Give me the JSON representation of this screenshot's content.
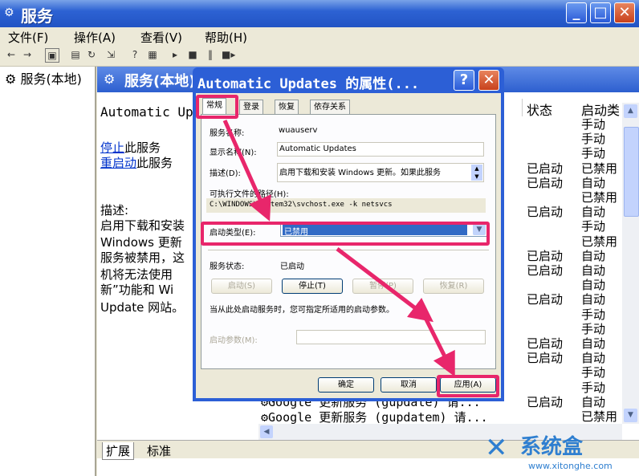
{
  "window": {
    "title": "服务",
    "minimize": "_",
    "maximize": "□",
    "close": "✕"
  },
  "menu": [
    "文件(F)",
    "操作(A)",
    "查看(V)",
    "帮助(H)"
  ],
  "left_pane": {
    "item": "服务(本地)"
  },
  "right_pane": {
    "header": "服务(本地)",
    "service_name": "Automatic Updates",
    "stop_link": "停止",
    "stop_suffix": "此服务",
    "restart_link": "重启动",
    "restart_suffix": "此服务",
    "desc_lines": [
      "描述:",
      "启用下载和安装",
      "Windows 更新",
      "服务被禁用，这",
      "机将无法使用",
      "新”功能和 Wi",
      "Update 网站。"
    ],
    "col_status": "状态",
    "col_startup": "启动类",
    "rows": [
      {
        "status": "",
        "startup": "手动"
      },
      {
        "status": "",
        "startup": "手动"
      },
      {
        "status": "",
        "startup": "手动"
      },
      {
        "status": "已启动",
        "startup": "已禁用"
      },
      {
        "status": "已启动",
        "startup": "自动"
      },
      {
        "status": "",
        "startup": "已禁用"
      },
      {
        "status": "已启动",
        "startup": "自动"
      },
      {
        "status": "",
        "startup": "手动"
      },
      {
        "status": "",
        "startup": "已禁用"
      },
      {
        "status": "已启动",
        "startup": "自动"
      },
      {
        "status": "已启动",
        "startup": "自动"
      },
      {
        "status": "",
        "startup": "自动"
      },
      {
        "status": "已启动",
        "startup": "自动"
      },
      {
        "status": "",
        "startup": "手动"
      },
      {
        "status": "",
        "startup": "手动"
      },
      {
        "status": "已启动",
        "startup": "自动"
      },
      {
        "status": "已启动",
        "startup": "自动"
      },
      {
        "status": "",
        "startup": "手动"
      },
      {
        "status": "",
        "startup": "手动"
      },
      {
        "status": "已启动",
        "startup": "自动"
      },
      {
        "status": "",
        "startup": "已禁用"
      },
      {
        "status": "",
        "startup": "已禁用"
      }
    ],
    "google_lines": [
      "Google 更新服务 (gupdate)  请...",
      "Google 更新服务 (gupdatem) 请..."
    ],
    "bottom_tabs": [
      "扩展",
      "标准"
    ]
  },
  "dialog": {
    "title": "Automatic Updates 的属性(...",
    "help": "?",
    "close": "✕",
    "tabs": [
      "常规",
      "登录",
      "恢复",
      "依存关系"
    ],
    "service_name_label": "服务名称:",
    "service_name_value": "wuauserv",
    "display_name_label": "显示名称(N):",
    "display_name_value": "Automatic Updates",
    "description_label": "描述(D):",
    "description_value": "启用下载和安装 Windows 更新。如果此服务",
    "exe_path_label": "可执行文件的路径(H):",
    "exe_path_value": "C:\\WINDOWS\\system32\\svchost.exe -k netsvcs",
    "startup_type_label": "启动类型(E):",
    "startup_type_value": "已禁用",
    "service_status_label": "服务状态:",
    "service_status_value": "已启动",
    "buttons": {
      "start": "启动(S)",
      "stop": "停止(T)",
      "pause": "暂停(P)",
      "resume": "恢复(R)"
    },
    "hint": "当从此处启动服务时，您可指定所适用的启动参数。",
    "start_params_label": "启动参数(M):",
    "ok": "确定",
    "cancel": "取消",
    "apply": "应用(A)"
  },
  "watermark": {
    "text": "系统盒",
    "url": "www.xitonghe.com"
  },
  "colors": {
    "highlight": "#e8266b",
    "xp_blue": "#2d62d3",
    "selection": "#316ac5"
  }
}
